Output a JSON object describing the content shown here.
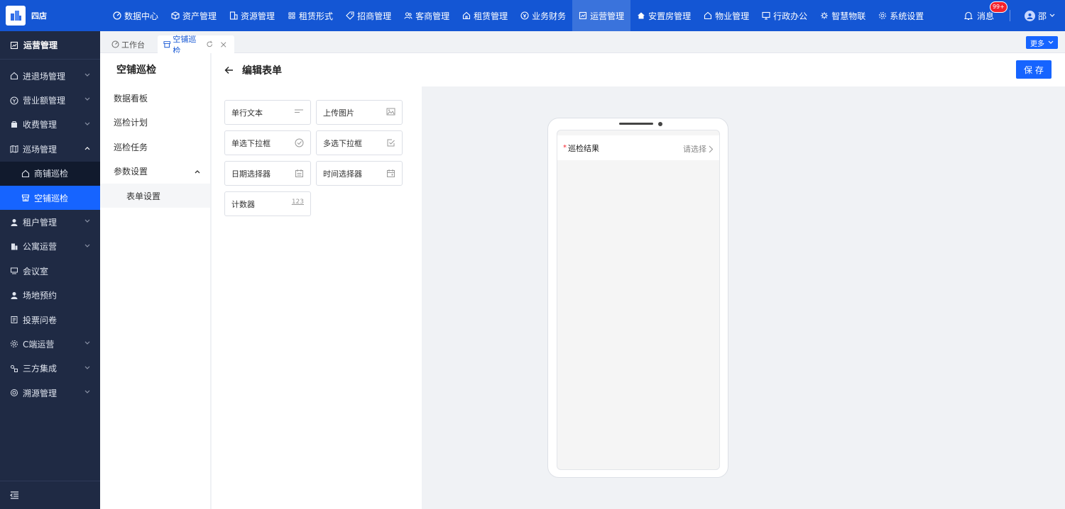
{
  "app": {
    "brand": "四店"
  },
  "topnav": [
    {
      "label": "数据中心",
      "icon": "dashboard-icon",
      "active": false
    },
    {
      "label": "资产管理",
      "icon": "cube-icon",
      "active": false
    },
    {
      "label": "资源管理",
      "icon": "building-icon",
      "active": false
    },
    {
      "label": "租赁形式",
      "icon": "grid-icon",
      "active": false
    },
    {
      "label": "招商管理",
      "icon": "tag-icon",
      "active": false
    },
    {
      "label": "客商管理",
      "icon": "users-icon",
      "active": false
    },
    {
      "label": "租赁管理",
      "icon": "home-icon",
      "active": false
    },
    {
      "label": "业务财务",
      "icon": "coin-icon",
      "active": false
    },
    {
      "label": "运营管理",
      "icon": "operation-icon",
      "active": true
    },
    {
      "label": "安置房管理",
      "icon": "house-icon",
      "active": false
    },
    {
      "label": "物业管理",
      "icon": "property-icon",
      "active": false
    },
    {
      "label": "行政办公",
      "icon": "monitor-icon",
      "active": false
    },
    {
      "label": "智慧物联",
      "icon": "iot-icon",
      "active": false
    },
    {
      "label": "系统设置",
      "icon": "settings-icon",
      "active": false
    }
  ],
  "header": {
    "messages_label": "消息",
    "messages_badge": "99+",
    "user_name": "邵"
  },
  "sidebar": {
    "title": "运营管理",
    "items": [
      {
        "label": "进退场管理",
        "expandable": true
      },
      {
        "label": "营业额管理",
        "expandable": true
      },
      {
        "label": "收费管理",
        "expandable": true
      },
      {
        "label": "巡场管理",
        "expandable": true,
        "expanded": true
      },
      {
        "label": "商铺巡检",
        "sub": true
      },
      {
        "label": "空铺巡检",
        "sub": true,
        "active": true
      },
      {
        "label": "租户管理",
        "expandable": true
      },
      {
        "label": "公寓运营",
        "expandable": true
      },
      {
        "label": "会议室",
        "expandable": false
      },
      {
        "label": "场地预约",
        "expandable": false
      },
      {
        "label": "投票问卷",
        "expandable": false
      },
      {
        "label": "C端运营",
        "expandable": true
      },
      {
        "label": "三方集成",
        "expandable": true
      },
      {
        "label": "溯源管理",
        "expandable": true
      }
    ]
  },
  "tabs": [
    {
      "label": "工作台",
      "active": false
    },
    {
      "label": "空铺巡检",
      "active": true
    }
  ],
  "more_label": "更多",
  "subnav": {
    "title": "空铺巡检",
    "items": [
      "数据看板",
      "巡检计划",
      "巡检任务",
      "参数设置"
    ],
    "sub_items": [
      "表单设置"
    ]
  },
  "editor": {
    "title": "编辑表单",
    "save_label": "保 存"
  },
  "components": [
    "单行文本",
    "上传图片",
    "单选下拉框",
    "多选下拉框",
    "日期选择器",
    "时间选择器",
    "计数器"
  ],
  "counter_icon_text": "123",
  "preview": {
    "field_label": "巡检结果",
    "field_placeholder": "请选择",
    "required": true
  }
}
